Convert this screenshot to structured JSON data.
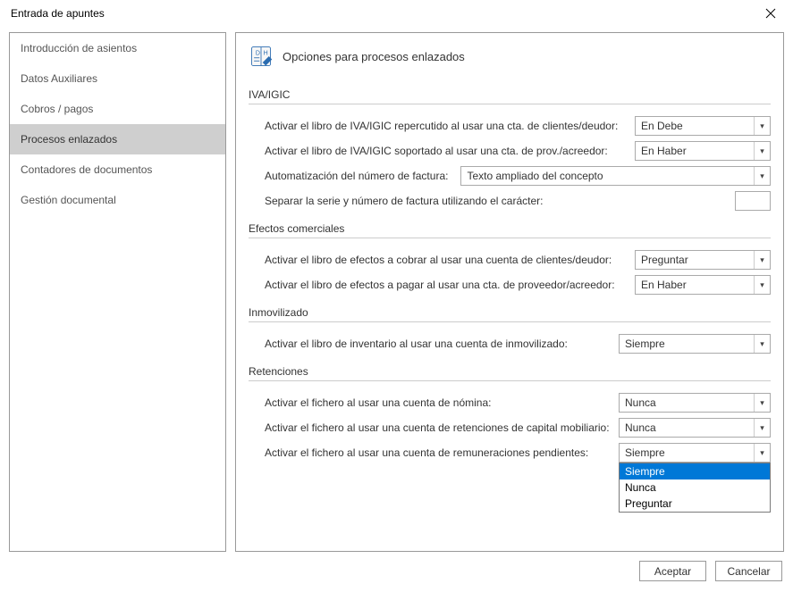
{
  "window": {
    "title": "Entrada de apuntes"
  },
  "sidebar": {
    "items": [
      {
        "label": "Introducción de asientos",
        "selected": false
      },
      {
        "label": "Datos Auxiliares",
        "selected": false
      },
      {
        "label": "Cobros / pagos",
        "selected": false
      },
      {
        "label": "Procesos enlazados",
        "selected": true
      },
      {
        "label": "Contadores de documentos",
        "selected": false
      },
      {
        "label": "Gestión documental",
        "selected": false
      }
    ]
  },
  "panel": {
    "title": "Opciones para procesos enlazados"
  },
  "sections": {
    "iva": {
      "heading": "IVA/IGIC",
      "row1_label": "Activar el libro de IVA/IGIC repercutido al usar una cta. de clientes/deudor:",
      "row1_value": "En Debe",
      "row2_label": "Activar el libro de IVA/IGIC soportado al usar una cta. de prov./acreedor:",
      "row2_value": "En Haber",
      "row3_label": "Automatización del número de factura:",
      "row3_value": "Texto ampliado del concepto",
      "row4_label": "Separar la serie y número de factura utilizando el carácter:",
      "row4_value": ""
    },
    "efectos": {
      "heading": "Efectos comerciales",
      "row1_label": "Activar el libro de efectos a cobrar al usar una cuenta de clientes/deudor:",
      "row1_value": "Preguntar",
      "row2_label": "Activar el libro de efectos a pagar al usar una cta. de proveedor/acreedor:",
      "row2_value": "En Haber"
    },
    "inmovilizado": {
      "heading": "Inmovilizado",
      "row1_label": "Activar el libro de inventario al usar una cuenta de inmovilizado:",
      "row1_value": "Siempre"
    },
    "retenciones": {
      "heading": "Retenciones",
      "row1_label": "Activar el fichero al usar una cuenta de nómina:",
      "row1_value": "Nunca",
      "row2_label": "Activar el fichero al usar una cuenta de retenciones de capital mobiliario:",
      "row2_value": "Nunca",
      "row3_label": "Activar el fichero al usar una cuenta de remuneraciones pendientes:",
      "row3_value": "Siempre",
      "row3_options": [
        "Siempre",
        "Nunca",
        "Preguntar"
      ]
    }
  },
  "buttons": {
    "accept": "Aceptar",
    "cancel": "Cancelar"
  }
}
